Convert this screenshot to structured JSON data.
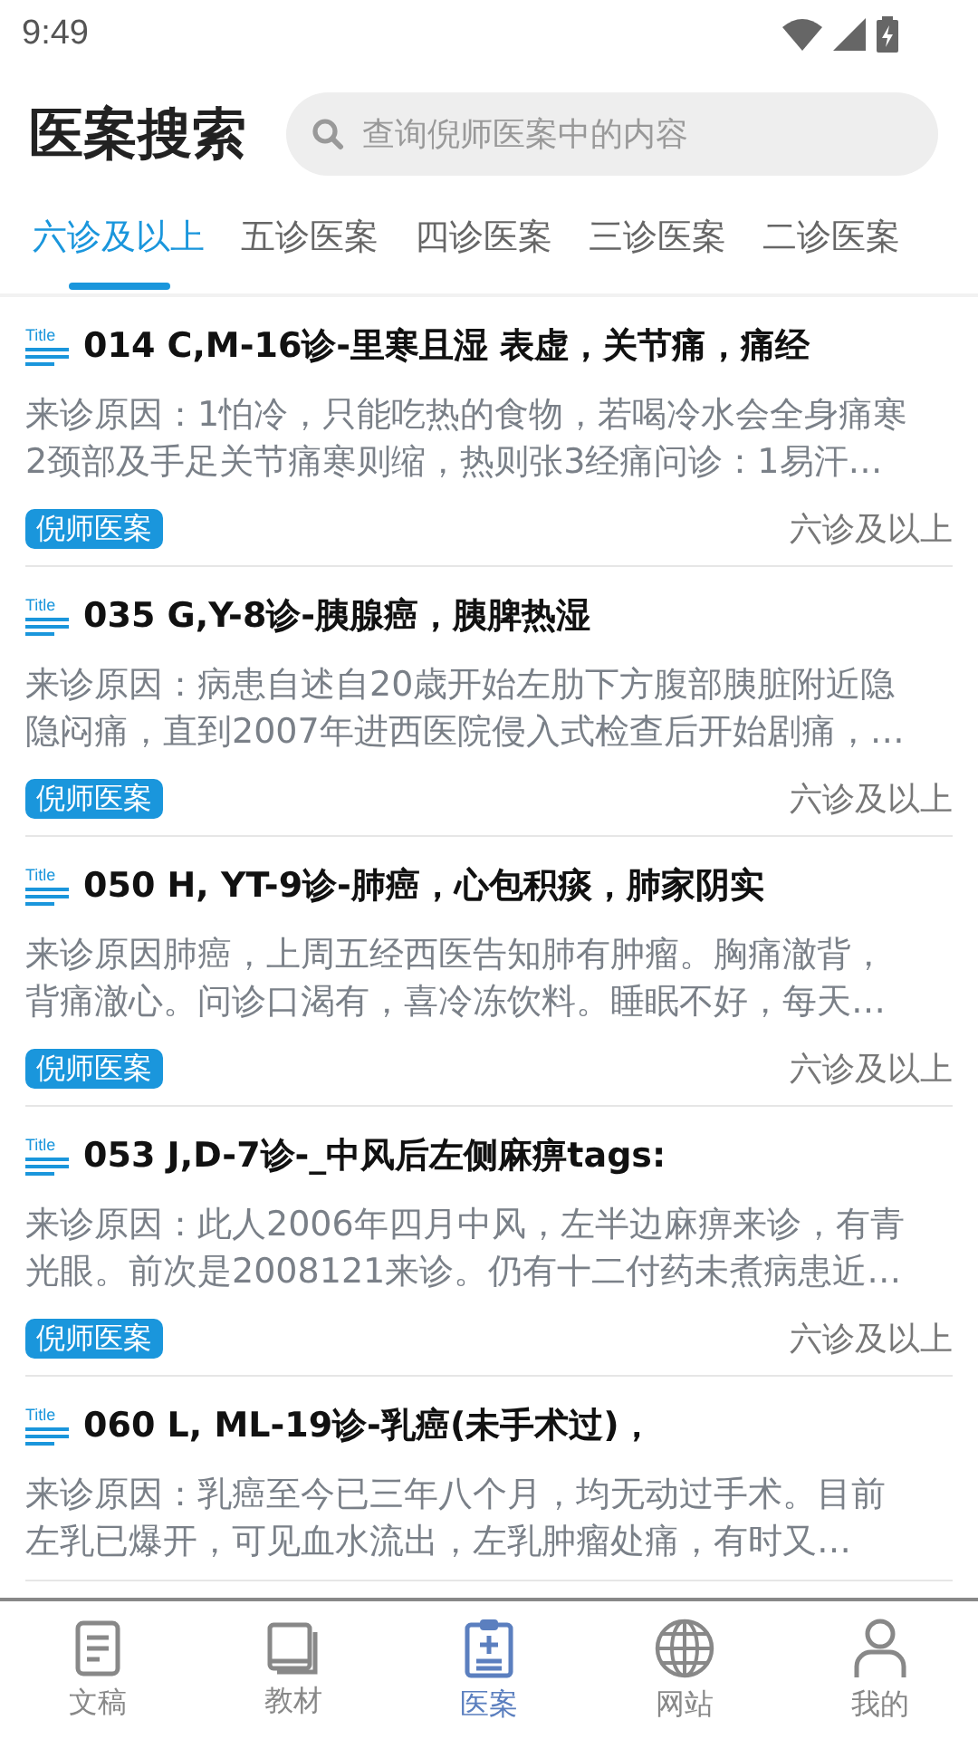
{
  "status_bar": {
    "time": "9:49"
  },
  "header": {
    "title": "医案搜索",
    "search": {
      "placeholder": "查询倪师医案中的内容"
    }
  },
  "tabs": [
    {
      "label": "六诊及以上",
      "selected": true
    },
    {
      "label": "五诊医案",
      "selected": false
    },
    {
      "label": "四诊医案",
      "selected": false
    },
    {
      "label": "三诊医案",
      "selected": false
    },
    {
      "label": "二诊医案",
      "selected": false
    }
  ],
  "cases": [
    {
      "icon_text": "Title",
      "title": "014 C,M-16诊-里寒且湿 表虚，关节痛，痛经",
      "description_lines": [
        "来诊原因：1怕冷，只能吃热的食物，若喝冷水会全身痛寒",
        "2颈部及手足关节痛寒则缩，热则张3经痛问诊：1易汗…"
      ],
      "tag": "倪师医案",
      "category": "六诊及以上"
    },
    {
      "icon_text": "Title",
      "title": "035 G,Y-8诊-胰腺癌，胰脾热湿",
      "description_lines": [
        "来诊原因：病患自述自20歳开始左肋下方腹部胰脏附近隐",
        "隐闷痛，直到2007年进西医院侵入式检查后开始剧痛，…"
      ],
      "tag": "倪师医案",
      "category": "六诊及以上"
    },
    {
      "icon_text": "Title",
      "title": "050 H, YT-9诊-肺癌，心包积痰，肺家阴实",
      "description_lines": [
        "来诊原因肺癌，上周五经西医告知肺有肿瘤。胸痛澈背，",
        "背痛澈心。问诊口渴有，喜冷冻饮料。睡眠不好，每天…"
      ],
      "tag": "倪师医案",
      "category": "六诊及以上"
    },
    {
      "icon_text": "Title",
      "title": "053 J,D-7诊-_中风后左侧麻痹tags:",
      "description_lines": [
        "来诊原因：此人2006年四月中风，左半边麻痹来诊，有青",
        "光眼。前次是2008121来诊。仍有十二付药未煮病患近…"
      ],
      "tag": "倪师医案",
      "category": "六诊及以上"
    },
    {
      "icon_text": "Title",
      "title": "060 L, ML-19诊-乳癌(未手术过)，",
      "description_lines": [
        "来诊原因：乳癌至今已三年八个月，均无动过手术。目前",
        "左乳已爆开，可见血水流出，左乳肿瘤处痛，有时又…"
      ]
    }
  ],
  "bottom_nav": [
    {
      "kind": "document",
      "label": "文稿",
      "selected": false
    },
    {
      "kind": "book",
      "label": "教材",
      "selected": false
    },
    {
      "kind": "clipboard",
      "label": "医案",
      "selected": true
    },
    {
      "kind": "globe",
      "label": "网站",
      "selected": false
    },
    {
      "kind": "person",
      "label": "我的",
      "selected": false
    }
  ]
}
